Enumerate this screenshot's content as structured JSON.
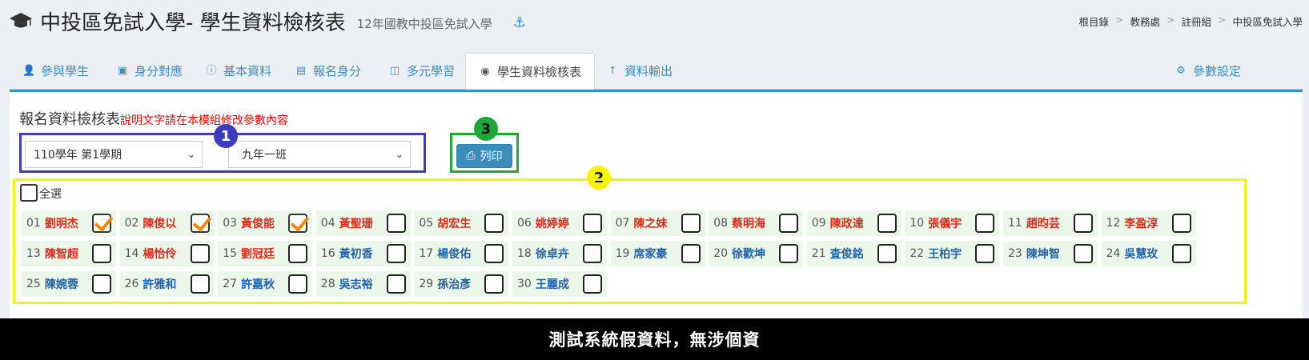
{
  "header": {
    "title": "中投區免試入學- 學生資料檢核表",
    "subtitle": "12年國教中投區免試入學"
  },
  "breadcrumb": [
    "根目錄",
    "教務處",
    "註冊組",
    "中投區免試入學"
  ],
  "tabs": [
    {
      "label": "參與學生",
      "icon": "user-plus-icon"
    },
    {
      "label": "身分對應",
      "icon": "id-badge-icon"
    },
    {
      "label": "基本資料",
      "icon": "info-circle-icon"
    },
    {
      "label": "報名身分",
      "icon": "id-card-icon"
    },
    {
      "label": "多元學習",
      "icon": "book-icon"
    },
    {
      "label": "學生資料檢核表",
      "icon": "check-eye-icon",
      "active": true
    },
    {
      "label": "資料輸出",
      "icon": "upload-icon"
    }
  ],
  "settings_label": "參數設定",
  "panel": {
    "title": "報名資料檢核表",
    "note": "說明文字請在本模組修改參數內容",
    "semester_select": "110學年 第1學期",
    "class_select": "九年一班",
    "print_label": "列印",
    "select_all_label": "全選"
  },
  "markers": [
    "1",
    "2",
    "3"
  ],
  "students": [
    {
      "num": "01",
      "name": "劉明杰",
      "color": "red",
      "checked": true
    },
    {
      "num": "02",
      "name": "陳俊以",
      "color": "red",
      "checked": true
    },
    {
      "num": "03",
      "name": "黃俊能",
      "color": "red",
      "checked": true
    },
    {
      "num": "04",
      "name": "黃聖珊",
      "color": "red",
      "checked": false
    },
    {
      "num": "05",
      "name": "胡宏生",
      "color": "red",
      "checked": false
    },
    {
      "num": "06",
      "name": "姚婷婷",
      "color": "red",
      "checked": false
    },
    {
      "num": "07",
      "name": "陳之妹",
      "color": "red",
      "checked": false
    },
    {
      "num": "08",
      "name": "蔡明海",
      "color": "red",
      "checked": false
    },
    {
      "num": "09",
      "name": "陳政達",
      "color": "red",
      "checked": false
    },
    {
      "num": "10",
      "name": "張儀宇",
      "color": "red",
      "checked": false
    },
    {
      "num": "11",
      "name": "趙昀芸",
      "color": "red",
      "checked": false
    },
    {
      "num": "12",
      "name": "李盈淳",
      "color": "red",
      "checked": false
    },
    {
      "num": "13",
      "name": "陳智超",
      "color": "red",
      "checked": false
    },
    {
      "num": "14",
      "name": "楊怡伶",
      "color": "red",
      "checked": false
    },
    {
      "num": "15",
      "name": "劉冠廷",
      "color": "red",
      "checked": false
    },
    {
      "num": "16",
      "name": "黃初香",
      "color": "blue",
      "checked": false
    },
    {
      "num": "17",
      "name": "楊俊佑",
      "color": "blue",
      "checked": false
    },
    {
      "num": "18",
      "name": "徐卓卉",
      "color": "blue",
      "checked": false
    },
    {
      "num": "19",
      "name": "席家豪",
      "color": "blue",
      "checked": false
    },
    {
      "num": "20",
      "name": "徐歡坤",
      "color": "blue",
      "checked": false
    },
    {
      "num": "21",
      "name": "査俊銘",
      "color": "blue",
      "checked": false
    },
    {
      "num": "22",
      "name": "王柏宇",
      "color": "blue",
      "checked": false
    },
    {
      "num": "23",
      "name": "陳坤智",
      "color": "blue",
      "checked": false
    },
    {
      "num": "24",
      "name": "吳慧玫",
      "color": "blue",
      "checked": false
    },
    {
      "num": "25",
      "name": "陳婉蓉",
      "color": "blue",
      "checked": false
    },
    {
      "num": "26",
      "name": "許雅和",
      "color": "blue",
      "checked": false
    },
    {
      "num": "27",
      "name": "許嘉秋",
      "color": "blue",
      "checked": false
    },
    {
      "num": "28",
      "name": "吳志裕",
      "color": "blue",
      "checked": false
    },
    {
      "num": "29",
      "name": "孫治彥",
      "color": "blue",
      "checked": false
    },
    {
      "num": "30",
      "name": "王麗成",
      "color": "blue",
      "checked": false
    }
  ],
  "footer": "測試系統假資料，無涉個資",
  "colors": {
    "accent": "#3c8dbc",
    "marker1": "#3c3cbf",
    "marker2": "#f5f500",
    "marker3": "#1fa83a",
    "name_red": "#dd2a1b",
    "name_blue": "#2262a8",
    "check": "#f08a00"
  }
}
